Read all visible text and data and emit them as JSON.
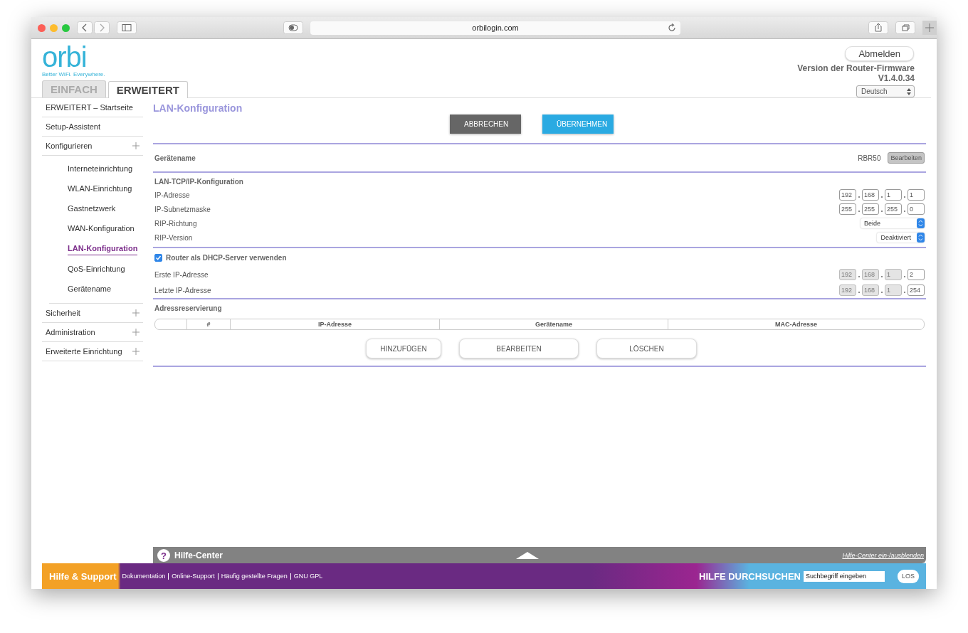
{
  "browser": {
    "url": "orbilogin.com"
  },
  "header": {
    "logo": "orbi",
    "tagline": "Better WiFi. Everywhere.",
    "logout": "Abmelden",
    "firmware_label": "Version der Router-Firmware",
    "firmware_version": "V1.4.0.34",
    "language": "Deutsch",
    "tabs": [
      {
        "label": "EINFACH",
        "selected": false
      },
      {
        "label": "ERWEITERT",
        "selected": true
      }
    ]
  },
  "sidebar": {
    "items": [
      {
        "label": "ERWEITERT – Startseite",
        "selected": false
      },
      {
        "label": "Setup-Assistent",
        "selected": false
      },
      {
        "label": "Konfigurieren",
        "selected": false,
        "expandable": true,
        "children": [
          {
            "label": "Interneteinrichtung",
            "selected": false
          },
          {
            "label": "WLAN-Einrichtung",
            "selected": false
          },
          {
            "label": "Gastnetzwerk",
            "selected": false
          },
          {
            "label": "WAN-Konfiguration",
            "selected": false
          },
          {
            "label": "LAN-Konfiguration",
            "selected": true
          },
          {
            "label": "QoS-Einrichtung",
            "selected": false
          },
          {
            "label": "Gerätename",
            "selected": false
          }
        ]
      },
      {
        "label": "Sicherheit",
        "selected": false,
        "expandable": true
      },
      {
        "label": "Administration",
        "selected": false,
        "expandable": true
      },
      {
        "label": "Erweiterte Einrichtung",
        "selected": false,
        "expandable": true
      }
    ]
  },
  "page": {
    "title": "LAN-Konfiguration",
    "buttons": [
      {
        "label": "ABBRECHEN",
        "kind": "secondary"
      },
      {
        "label": "ÜBERNEHMEN",
        "kind": "primary"
      }
    ],
    "device_name": {
      "label": "Gerätename",
      "value": "RBR50",
      "button": "Bearbeiten"
    },
    "lan_tcp": {
      "title": "LAN-TCP/IP-Konfiguration",
      "rows": [
        {
          "kind": "ip",
          "label": "IP-Adresse",
          "octets": [
            {
              "value": "192",
              "disabled": false
            },
            {
              "value": "168",
              "disabled": false
            },
            {
              "value": "1",
              "disabled": false
            },
            {
              "value": "1",
              "disabled": false
            }
          ]
        },
        {
          "kind": "ip",
          "label": "IP-Subnetzmaske",
          "octets": [
            {
              "value": "255",
              "disabled": false
            },
            {
              "value": "255",
              "disabled": false
            },
            {
              "value": "255",
              "disabled": false
            },
            {
              "value": "0",
              "disabled": false
            }
          ]
        },
        {
          "kind": "select",
          "label": "RIP-Richtung",
          "value": "Beide"
        },
        {
          "kind": "select",
          "label": "RIP-Version",
          "value": "Deaktiviert"
        }
      ]
    },
    "dhcp": {
      "label": "Router als DHCP-Server verwenden",
      "checked": true,
      "rows": [
        {
          "kind": "ip",
          "label": "Erste IP-Adresse",
          "octets": [
            {
              "value": "192",
              "disabled": true
            },
            {
              "value": "168",
              "disabled": true
            },
            {
              "value": "1",
              "disabled": true
            },
            {
              "value": "2",
              "disabled": false
            }
          ]
        },
        {
          "kind": "ip",
          "label": "Letzte IP-Adresse",
          "octets": [
            {
              "value": "192",
              "disabled": true
            },
            {
              "value": "168",
              "disabled": true
            },
            {
              "value": "1",
              "disabled": true
            },
            {
              "value": "254",
              "disabled": false
            }
          ]
        }
      ]
    },
    "reservation": {
      "title": "Adressreservierung",
      "columns": [
        "#",
        "IP-Adresse",
        "Gerätename",
        "MAC-Adresse"
      ],
      "buttons": [
        "HINZUFÜGEN",
        "BEARBEITEN",
        "LÖSCHEN"
      ]
    }
  },
  "help": {
    "icon": "?",
    "title": "Hilfe-Center",
    "toggle": "Hilfe-Center ein-/ausblenden"
  },
  "footer": {
    "title": "Hilfe & Support",
    "links": [
      "Dokumentation",
      "Online-Support",
      "Häufig gestellte Fragen",
      "GNU GPL"
    ],
    "search_label": "HILFE DURCHSUCHEN",
    "search_placeholder": "Suchbegriff eingeben",
    "search_button": "LOS"
  }
}
